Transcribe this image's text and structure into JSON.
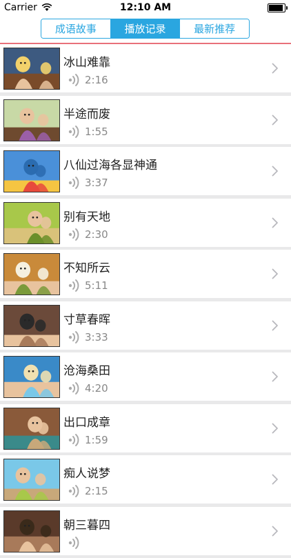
{
  "status": {
    "carrier": "Carrier",
    "time": "12:10 AM"
  },
  "tabs": [
    {
      "label": "成语故事",
      "active": false
    },
    {
      "label": "播放记录",
      "active": true
    },
    {
      "label": "最新推荐",
      "active": false
    }
  ],
  "items": [
    {
      "title": "冰山难靠",
      "duration": "2:16"
    },
    {
      "title": "半途而废",
      "duration": "1:55"
    },
    {
      "title": "八仙过海各显神通",
      "duration": "3:37"
    },
    {
      "title": "别有天地",
      "duration": "2:30"
    },
    {
      "title": "不知所云",
      "duration": "5:11"
    },
    {
      "title": "寸草春晖",
      "duration": "3:33"
    },
    {
      "title": "沧海桑田",
      "duration": "4:20"
    },
    {
      "title": "出口成章",
      "duration": "1:59"
    },
    {
      "title": "痴人说梦",
      "duration": "2:15"
    },
    {
      "title": "朝三暮四",
      "duration": ""
    }
  ],
  "colors": {
    "accent": "#2aa6e0",
    "separator": "#e8707a"
  }
}
